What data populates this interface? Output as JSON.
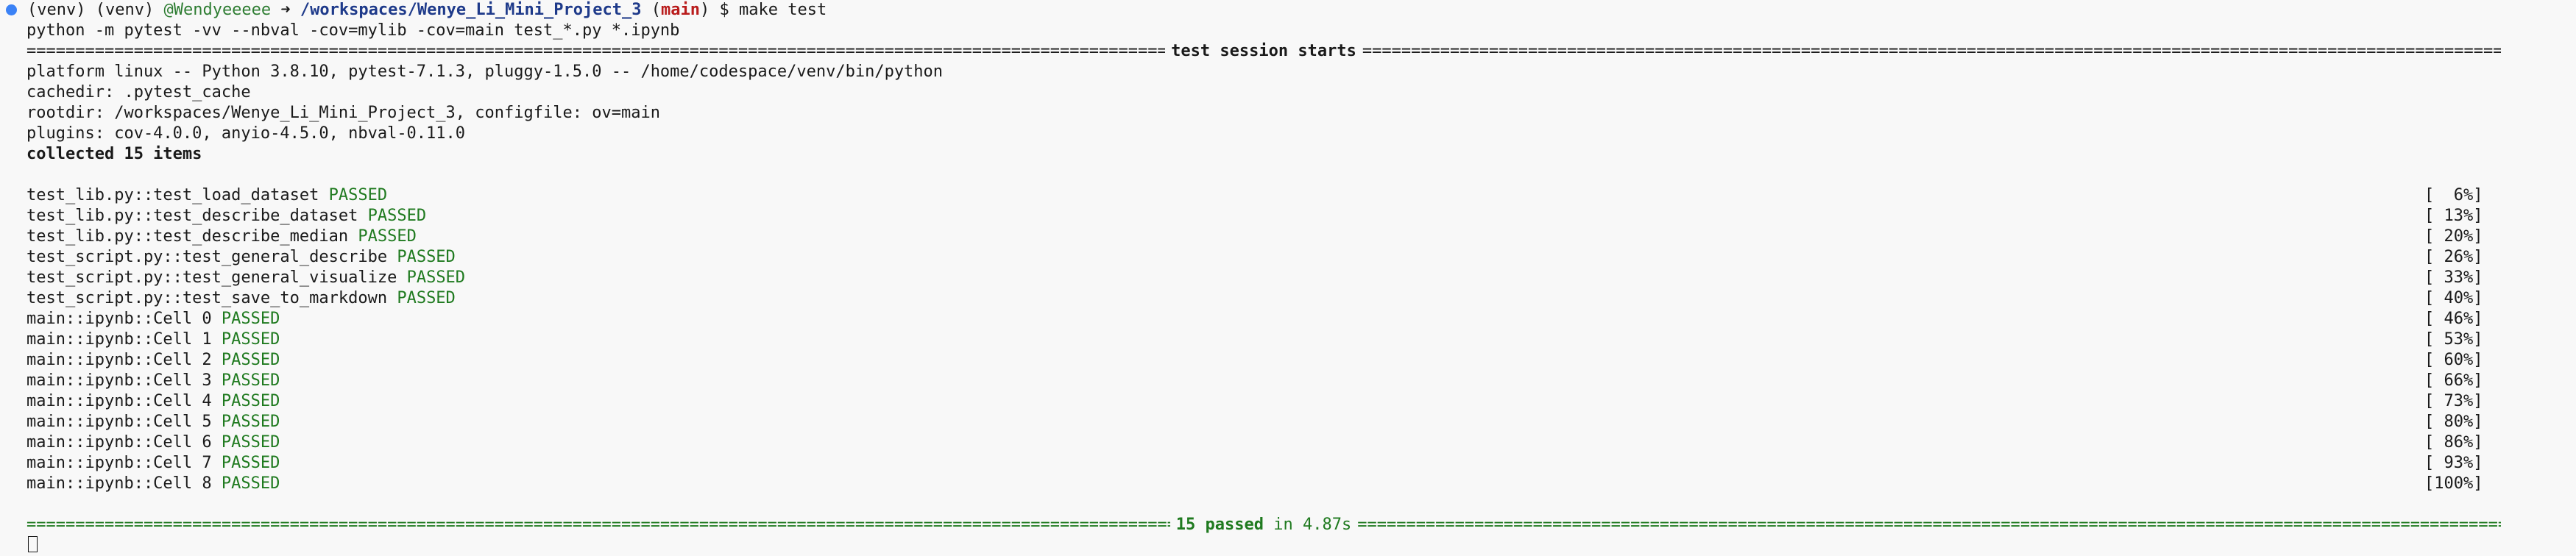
{
  "prompt": {
    "venv1": "(venv)",
    "venv2": "(venv)",
    "user": "@Wendyeeeee",
    "arrow": "➜",
    "cwd": "/workspaces/Wenye_Li_Mini_Project_3",
    "branch_open": "(",
    "branch": "main",
    "branch_close": ")",
    "dollar": "$",
    "command": "make test"
  },
  "echoed_command": "python -m pytest -vv --nbval -cov=mylib -cov=main test_*.py *.ipynb",
  "session_header": "test session starts",
  "info_lines": [
    "platform linux -- Python 3.8.10, pytest-7.1.3, pluggy-1.5.0 -- /home/codespace/venv/bin/python",
    "cachedir: .pytest_cache",
    "rootdir: /workspaces/Wenye_Li_Mini_Project_3, configfile: ov=main",
    "plugins: cov-4.0.0, anyio-4.5.0, nbval-0.11.0"
  ],
  "collected": "collected 15 items",
  "tests": [
    {
      "name": "test_lib.py::test_load_dataset",
      "status": "PASSED",
      "pct": "[  6%]"
    },
    {
      "name": "test_lib.py::test_describe_dataset",
      "status": "PASSED",
      "pct": "[ 13%]"
    },
    {
      "name": "test_lib.py::test_describe_median",
      "status": "PASSED",
      "pct": "[ 20%]"
    },
    {
      "name": "test_script.py::test_general_describe",
      "status": "PASSED",
      "pct": "[ 26%]"
    },
    {
      "name": "test_script.py::test_general_visualize",
      "status": "PASSED",
      "pct": "[ 33%]"
    },
    {
      "name": "test_script.py::test_save_to_markdown",
      "status": "PASSED",
      "pct": "[ 40%]"
    },
    {
      "name": "main::ipynb::Cell 0",
      "status": "PASSED",
      "pct": "[ 46%]"
    },
    {
      "name": "main::ipynb::Cell 1",
      "status": "PASSED",
      "pct": "[ 53%]"
    },
    {
      "name": "main::ipynb::Cell 2",
      "status": "PASSED",
      "pct": "[ 60%]"
    },
    {
      "name": "main::ipynb::Cell 3",
      "status": "PASSED",
      "pct": "[ 66%]"
    },
    {
      "name": "main::ipynb::Cell 4",
      "status": "PASSED",
      "pct": "[ 73%]"
    },
    {
      "name": "main::ipynb::Cell 5",
      "status": "PASSED",
      "pct": "[ 80%]"
    },
    {
      "name": "main::ipynb::Cell 6",
      "status": "PASSED",
      "pct": "[ 86%]"
    },
    {
      "name": "main::ipynb::Cell 7",
      "status": "PASSED",
      "pct": "[ 93%]"
    },
    {
      "name": "main::ipynb::Cell 8",
      "status": "PASSED",
      "pct": "[100%]"
    }
  ],
  "summary": {
    "passed": "15 passed",
    "time": "in 4.87s"
  },
  "colors": {
    "background": "#f8f8f8",
    "passed": "#1f7a1f",
    "path": "#1e3a8a",
    "branch": "#b91c1c",
    "user": "#2e7d32",
    "dot": "#3b82f6"
  }
}
